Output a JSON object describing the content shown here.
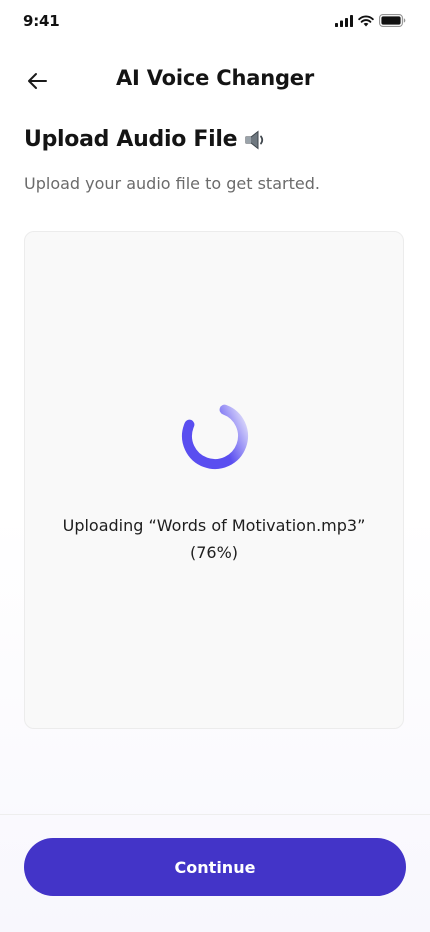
{
  "status_bar": {
    "time": "9:41",
    "icons": [
      "signal-icon",
      "wifi-icon",
      "battery-icon"
    ]
  },
  "header": {
    "back_icon": "arrow-left-icon",
    "title": "AI Voice Changer"
  },
  "page": {
    "title": "Upload Audio File",
    "title_icon": "speaker-icon",
    "subtitle": "Upload your audio file to get started."
  },
  "upload": {
    "filename": "Words of Motivation.mp3",
    "status_line": "Uploading “Words of Motivation.mp3”",
    "percent_label": "(76%)",
    "progress_percent": 76,
    "spinner_icon": "loading-spinner-icon"
  },
  "footer": {
    "continue_label": "Continue"
  },
  "colors": {
    "accent": "#4334c8",
    "spinner_start": "#5a4ef0"
  }
}
